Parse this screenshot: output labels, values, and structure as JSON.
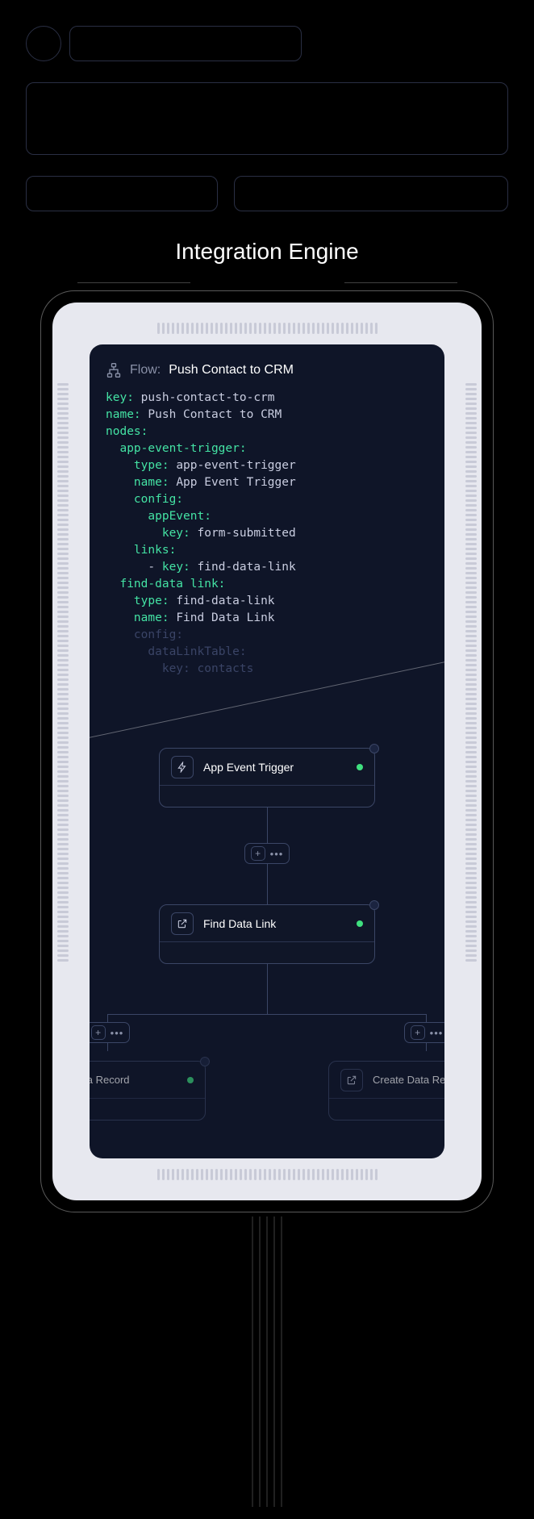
{
  "section_title": "Integration Engine",
  "flow": {
    "header_prefix": "Flow:",
    "header_name": "Push Contact to CRM"
  },
  "code": {
    "l1k": "key:",
    "l1v": "push-contact-to-crm",
    "l2k": "name:",
    "l2v": "Push Contact to CRM",
    "l3k": "nodes:",
    "l4k": "app-event-trigger:",
    "l5k": "type:",
    "l5v": "app-event-trigger",
    "l6k": "name:",
    "l6v": "App Event Trigger",
    "l7k": "config:",
    "l8k": "appEvent:",
    "l9k": "key:",
    "l9v": "form-submitted",
    "l10k": "links:",
    "l11b": "- ",
    "l11k": "key:",
    "l11v": "find-data-link",
    "l12k": "find-data link:",
    "l13k": "type:",
    "l13v": "find-data-link",
    "l14k": "name:",
    "l14v": "Find Data Link",
    "l15k": "config:",
    "l16k": "dataLinkTable:",
    "l17k": "key:",
    "l17v": "contacts"
  },
  "nodes": {
    "n1": "App Event Trigger",
    "n2": "Find Data Link",
    "n3": "Update Data Record",
    "n4": "Create Data Record"
  }
}
